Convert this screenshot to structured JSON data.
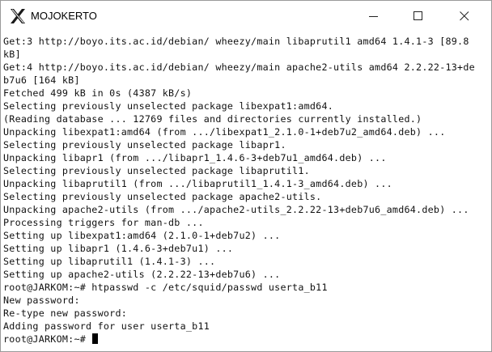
{
  "window": {
    "title": "MOJOKERTO",
    "app_icon": "x-terminal-icon",
    "controls": [
      "minimize-icon",
      "maximize-icon",
      "close-icon"
    ]
  },
  "terminal": {
    "lines": [
      "Get:3 http://boyo.its.ac.id/debian/ wheezy/main libaprutil1 amd64 1.4.1-3 [89.8",
      "kB]",
      "Get:4 http://boyo.its.ac.id/debian/ wheezy/main apache2-utils amd64 2.2.22-13+de",
      "b7u6 [164 kB]",
      "Fetched 499 kB in 0s (4387 kB/s)",
      "Selecting previously unselected package libexpat1:amd64.",
      "(Reading database ... 12769 files and directories currently installed.)",
      "Unpacking libexpat1:amd64 (from .../libexpat1_2.1.0-1+deb7u2_amd64.deb) ...",
      "Selecting previously unselected package libapr1.",
      "Unpacking libapr1 (from .../libapr1_1.4.6-3+deb7u1_amd64.deb) ...",
      "Selecting previously unselected package libaprutil1.",
      "Unpacking libaprutil1 (from .../libaprutil1_1.4.1-3_amd64.deb) ...",
      "Selecting previously unselected package apache2-utils.",
      "Unpacking apache2-utils (from .../apache2-utils_2.2.22-13+deb7u6_amd64.deb) ...",
      "Processing triggers for man-db ...",
      "Setting up libexpat1:amd64 (2.1.0-1+deb7u2) ...",
      "Setting up libapr1 (1.4.6-3+deb7u1) ...",
      "Setting up libaprutil1 (1.4.1-3) ...",
      "Setting up apache2-utils (2.2.22-13+deb7u6) ...",
      "root@JARKOM:~# htpasswd -c /etc/squid/passwd userta_b11",
      "New password:",
      "Re-type new password:",
      "Adding password for user userta_b11"
    ],
    "prompt": "root@JARKOM:~# "
  }
}
